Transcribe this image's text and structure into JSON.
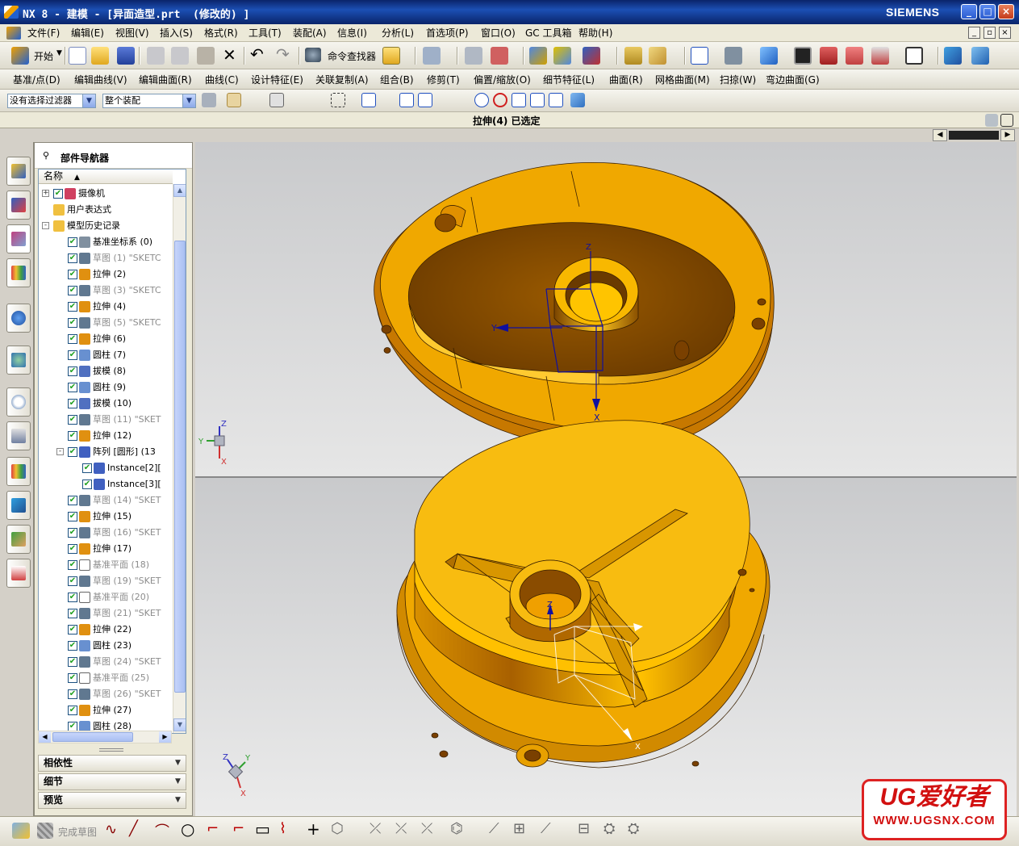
{
  "window": {
    "title": "NX 8 - 建模 - [异面造型.prt  (修改的) ]",
    "brand": "SIEMENS",
    "controls": [
      "_",
      "□",
      "×"
    ]
  },
  "menubar": {
    "items": [
      "文件(F)",
      "编辑(E)",
      "视图(V)",
      "插入(S)",
      "格式(R)",
      "工具(T)",
      "装配(A)",
      "信息(I)",
      "分析(L)",
      "首选项(P)",
      "窗口(O)",
      "GC 工具箱",
      "帮助(H)"
    ]
  },
  "toolbar1": {
    "start_label": "开始",
    "command_finder_label": "命令查找器"
  },
  "toolbar2": {
    "items": [
      "基准/点(D)",
      "编辑曲线(V)",
      "编辑曲面(R)",
      "曲线(C)",
      "设计特征(E)",
      "关联复制(A)",
      "组合(B)",
      "修剪(T)",
      "偏置/缩放(O)",
      "细节特征(L)",
      "曲面(R)",
      "网格曲面(M)",
      "扫掠(W)",
      "弯边曲面(G)"
    ]
  },
  "selection_bar": {
    "filter_value": "没有选择过滤器",
    "scope_value": "整个装配"
  },
  "cue_line": "拉伸(4) 已选定",
  "navigator": {
    "title": "部件导航器",
    "column_header": "名称",
    "rows": [
      {
        "depth": 0,
        "expander": "+",
        "check": true,
        "icon": "camera",
        "text": "摄像机",
        "grey": false
      },
      {
        "depth": 0,
        "expander": "",
        "check": false,
        "icon": "folder",
        "text": "用户表达式",
        "grey": false
      },
      {
        "depth": 0,
        "expander": "-",
        "check": false,
        "icon": "folder",
        "text": "模型历史记录",
        "grey": false
      },
      {
        "depth": 1,
        "expander": "",
        "check": true,
        "icon": "csys",
        "text": "基准坐标系 (0)",
        "grey": false
      },
      {
        "depth": 1,
        "expander": "",
        "check": true,
        "icon": "sketch",
        "text": "草图 (1) \"SKETC",
        "grey": true
      },
      {
        "depth": 1,
        "expander": "",
        "check": true,
        "icon": "extrude",
        "text": "拉伸 (2)",
        "grey": false
      },
      {
        "depth": 1,
        "expander": "",
        "check": true,
        "icon": "sketch",
        "text": "草图 (3) \"SKETC",
        "grey": true
      },
      {
        "depth": 1,
        "expander": "",
        "check": true,
        "icon": "extrude",
        "text": "拉伸 (4)",
        "grey": false
      },
      {
        "depth": 1,
        "expander": "",
        "check": true,
        "icon": "sketch",
        "text": "草图 (5) \"SKETC",
        "grey": true
      },
      {
        "depth": 1,
        "expander": "",
        "check": true,
        "icon": "extrude",
        "text": "拉伸 (6)",
        "grey": false
      },
      {
        "depth": 1,
        "expander": "",
        "check": true,
        "icon": "cylinder",
        "text": "圆柱 (7)",
        "grey": false
      },
      {
        "depth": 1,
        "expander": "",
        "check": true,
        "icon": "draft",
        "text": "拔模 (8)",
        "grey": false
      },
      {
        "depth": 1,
        "expander": "",
        "check": true,
        "icon": "cylinder",
        "text": "圆柱 (9)",
        "grey": false
      },
      {
        "depth": 1,
        "expander": "",
        "check": true,
        "icon": "draft",
        "text": "拔模 (10)",
        "grey": false
      },
      {
        "depth": 1,
        "expander": "",
        "check": true,
        "icon": "sketch",
        "text": "草图 (11) \"SKET",
        "grey": true
      },
      {
        "depth": 1,
        "expander": "",
        "check": true,
        "icon": "extrude",
        "text": "拉伸 (12)",
        "grey": false
      },
      {
        "depth": 1,
        "expander": "-",
        "check": true,
        "icon": "pattern",
        "text": "阵列 [圆形] (13",
        "grey": false
      },
      {
        "depth": 2,
        "expander": "",
        "check": true,
        "icon": "instance",
        "text": "Instance[2][",
        "grey": false
      },
      {
        "depth": 2,
        "expander": "",
        "check": true,
        "icon": "instance",
        "text": "Instance[3][",
        "grey": false
      },
      {
        "depth": 1,
        "expander": "",
        "check": true,
        "icon": "sketch",
        "text": "草图 (14) \"SKET",
        "grey": true
      },
      {
        "depth": 1,
        "expander": "",
        "check": true,
        "icon": "extrude",
        "text": "拉伸 (15)",
        "grey": false
      },
      {
        "depth": 1,
        "expander": "",
        "check": true,
        "icon": "sketch",
        "text": "草图 (16) \"SKET",
        "grey": true
      },
      {
        "depth": 1,
        "expander": "",
        "check": true,
        "icon": "extrude",
        "text": "拉伸 (17)",
        "grey": false
      },
      {
        "depth": 1,
        "expander": "",
        "check": true,
        "icon": "plane",
        "text": "基准平面 (18)",
        "grey": true
      },
      {
        "depth": 1,
        "expander": "",
        "check": true,
        "icon": "sketch",
        "text": "草图 (19) \"SKET",
        "grey": true
      },
      {
        "depth": 1,
        "expander": "",
        "check": true,
        "icon": "plane",
        "text": "基准平面 (20)",
        "grey": true
      },
      {
        "depth": 1,
        "expander": "",
        "check": true,
        "icon": "sketch",
        "text": "草图 (21) \"SKET",
        "grey": true
      },
      {
        "depth": 1,
        "expander": "",
        "check": true,
        "icon": "extrude",
        "text": "拉伸 (22)",
        "grey": false
      },
      {
        "depth": 1,
        "expander": "",
        "check": true,
        "icon": "cylinder",
        "text": "圆柱 (23)",
        "grey": false
      },
      {
        "depth": 1,
        "expander": "",
        "check": true,
        "icon": "sketch",
        "text": "草图 (24) \"SKET",
        "grey": true
      },
      {
        "depth": 1,
        "expander": "",
        "check": true,
        "icon": "plane",
        "text": "基准平面 (25)",
        "grey": true
      },
      {
        "depth": 1,
        "expander": "",
        "check": true,
        "icon": "sketch",
        "text": "草图 (26) \"SKET",
        "grey": true
      },
      {
        "depth": 1,
        "expander": "",
        "check": true,
        "icon": "extrude",
        "text": "拉伸 (27)",
        "grey": false
      },
      {
        "depth": 1,
        "expander": "",
        "check": true,
        "icon": "cylinder",
        "text": "圆柱 (28)",
        "grey": false
      }
    ],
    "panels": [
      "相依性",
      "细节",
      "预览"
    ]
  },
  "viewport": {
    "part_color": "#f5b800",
    "top_triad": {
      "z": "Z",
      "y": "Y",
      "x": "X"
    },
    "bottom_triad": {
      "z": "Z",
      "y": "Y",
      "x": "X"
    }
  },
  "bottom_toolbar": {
    "finish_sketch_label": "完成草图"
  },
  "watermark": {
    "big": "UG爱好者",
    "small": "WWW.UGSNX.COM"
  },
  "colors": {
    "titlebar": "#0a246a",
    "accent": "#f5b800",
    "watermark_red": "#d21010"
  }
}
